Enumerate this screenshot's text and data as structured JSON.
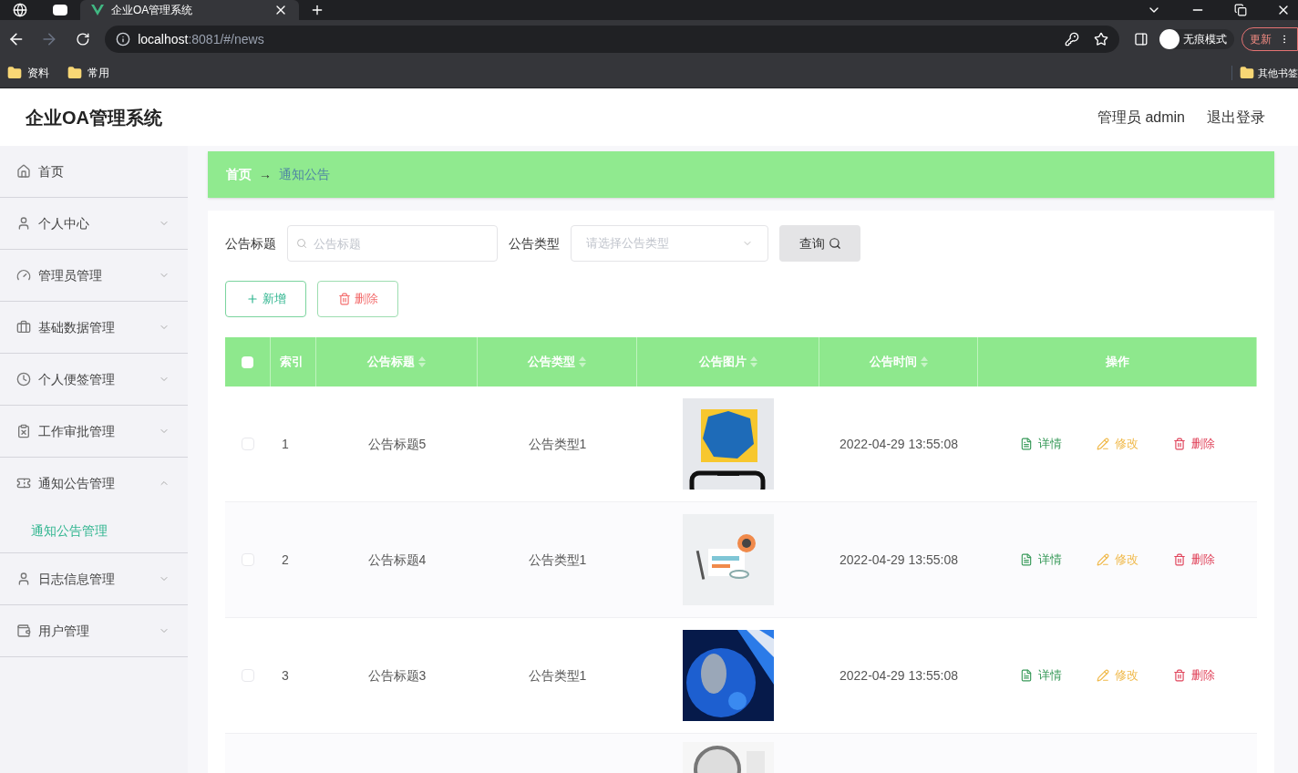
{
  "browser": {
    "tabs": [
      {
        "title": "企业OA管理系统",
        "selected": true
      }
    ],
    "url": {
      "host": "localhost",
      "path": ":8081/#/news"
    },
    "profile_label": "无痕模式",
    "update_button": "更新",
    "bookmarks": [
      "资料",
      "常用"
    ],
    "other_bookmarks": "其他书签"
  },
  "header": {
    "title": "企业OA管理系统",
    "user": "管理员 admin",
    "logout": "退出登录"
  },
  "sidebar": {
    "items": [
      {
        "label": "首页"
      },
      {
        "label": "个人中心",
        "expanded": false
      },
      {
        "label": "管理员管理",
        "expanded": false
      },
      {
        "label": "基础数据管理",
        "expanded": false
      },
      {
        "label": "个人便签管理",
        "expanded": false
      },
      {
        "label": "工作审批管理",
        "expanded": false
      },
      {
        "label": "通知公告管理",
        "expanded": true,
        "children": [
          {
            "label": "通知公告管理",
            "selected": true
          }
        ]
      },
      {
        "label": "日志信息管理",
        "expanded": false
      },
      {
        "label": "用户管理",
        "expanded": false
      }
    ]
  },
  "breadcrumb": [
    "首页",
    "通知公告"
  ],
  "breadcrumb_separator": "→",
  "filters": [
    {
      "label": "公告标题",
      "kind": "text",
      "placeholder": "公告标题"
    },
    {
      "label": "公告类型",
      "kind": "select",
      "placeholder": "请选择公告类型"
    }
  ],
  "search_button": "查询",
  "actions": [
    {
      "label": "新增",
      "kind": "add"
    },
    {
      "label": "删除",
      "kind": "delete"
    }
  ],
  "table": {
    "all_checked": false,
    "columns": [
      {
        "kind": "checkbox"
      },
      {
        "label": "索引",
        "kind": "text",
        "sortable": false
      },
      {
        "label": "公告标题",
        "kind": "text",
        "sortable": true
      },
      {
        "label": "公告类型",
        "kind": "text",
        "sortable": true
      },
      {
        "label": "公告图片",
        "kind": "text",
        "sortable": true
      },
      {
        "label": "公告时间",
        "kind": "text",
        "sortable": true
      },
      {
        "label": "操作",
        "kind": "text",
        "sortable": false
      }
    ],
    "rows": [
      {
        "checked": false,
        "index": "1",
        "title": "公告标题5",
        "type": "公告类型1",
        "picture": {
          "kind": "picture"
        },
        "time": "2022-04-29 13:55:08",
        "actions": [
          {
            "label": "详情",
            "kind": "detail",
            "color": "#3a9b5b"
          },
          {
            "label": "修改",
            "kind": "edit",
            "color": "#f0b94a"
          },
          {
            "label": "删除",
            "kind": "delete",
            "color": "#e0435a"
          }
        ]
      },
      {
        "checked": false,
        "index": "2",
        "title": "公告标题4",
        "type": "公告类型1",
        "picture": {
          "kind": "picture"
        },
        "time": "2022-04-29 13:55:08",
        "actions": [
          {
            "label": "详情",
            "kind": "detail",
            "color": "#3a9b5b"
          },
          {
            "label": "修改",
            "kind": "edit",
            "color": "#f0b94a"
          },
          {
            "label": "删除",
            "kind": "delete",
            "color": "#e0435a"
          }
        ]
      },
      {
        "checked": false,
        "index": "3",
        "title": "公告标题3",
        "type": "公告类型1",
        "picture": {
          "kind": "picture"
        },
        "time": "2022-04-29 13:55:08",
        "actions": [
          {
            "label": "详情",
            "kind": "detail",
            "color": "#3a9b5b"
          },
          {
            "label": "修改",
            "kind": "edit",
            "color": "#f0b94a"
          },
          {
            "label": "删除",
            "kind": "delete",
            "color": "#e0435a"
          }
        ]
      },
      {
        "picture": {
          "kind": "picture"
        }
      }
    ]
  }
}
